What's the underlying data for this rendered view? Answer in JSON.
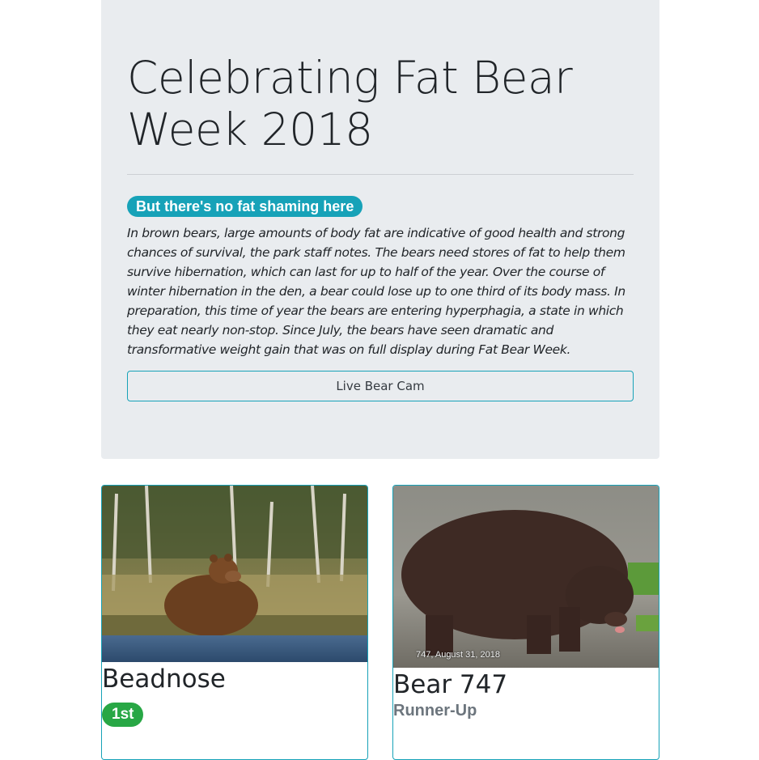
{
  "hero": {
    "title": "Celebrating Fat Bear Week 2018",
    "pill": "But there's no fat shaming here",
    "lede": "In brown bears, large amounts of body fat are indicative of good health and strong chances of survival, the park staff notes. The bears need stores of fat to help them survive hibernation, which can last for up to half of the year. Over the course of winter hibernation in the den, a bear could lose up to one third of its body mass. In preparation, this time of year the bears are entering hyperphagia, a state in which they eat nearly non-stop. Since July, the bears have seen dramatic and transformative weight gain that was on full display during Fat Bear Week.",
    "button_label": "Live Bear Cam"
  },
  "cards": [
    {
      "name": "Beadnose",
      "badge": "1st"
    },
    {
      "name": "Bear 747",
      "subtitle": "Runner-Up",
      "photo_caption": "747, August 31, 2018"
    }
  ],
  "colors": {
    "accent": "#17a2b8",
    "winner_badge": "#28a745",
    "jumbotron_bg": "#e9ecef"
  }
}
